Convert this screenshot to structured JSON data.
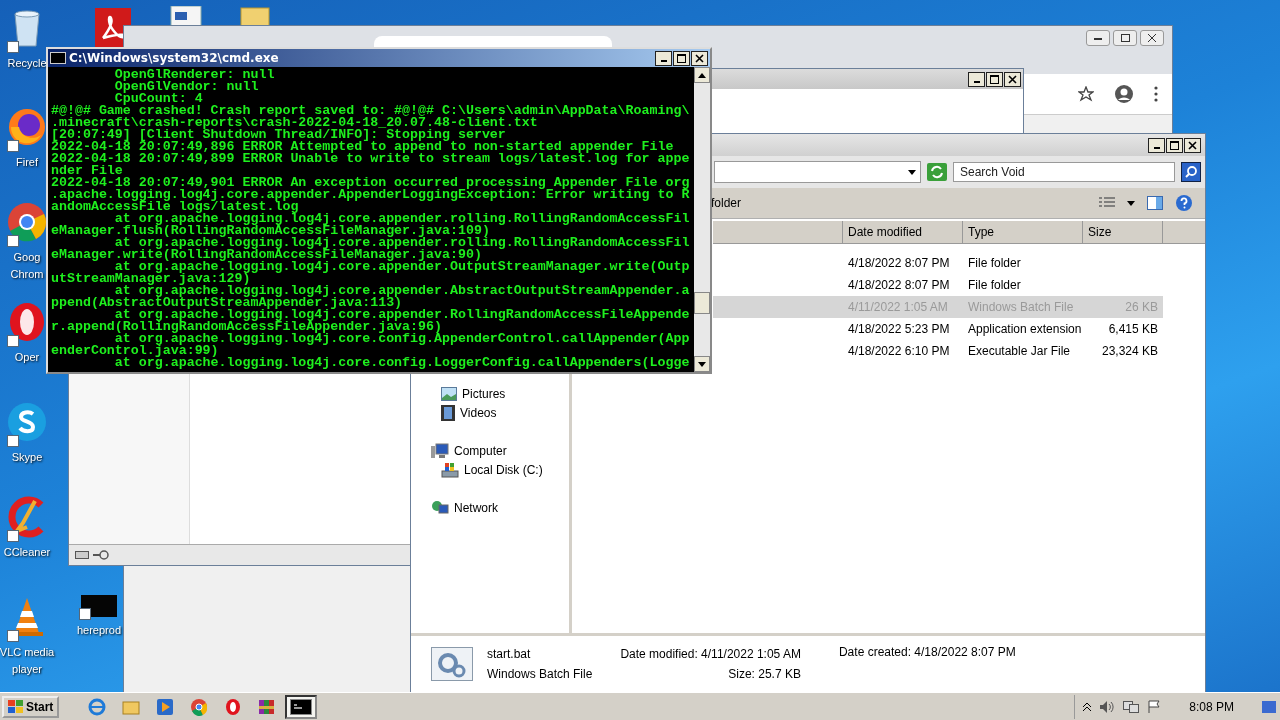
{
  "desktop_icons": [
    {
      "kind": "recycle-bin",
      "lines": [
        "Recycle"
      ]
    },
    {
      "kind": "pdf"
    },
    {
      "kind": "document"
    },
    {
      "kind": "folder"
    },
    {
      "kind": "firefox",
      "lines": [
        "Firef"
      ]
    },
    {
      "kind": "chrome",
      "lines": [
        "Goog",
        "Chrom"
      ]
    },
    {
      "kind": "opera",
      "lines": [
        "Oper"
      ]
    },
    {
      "kind": "skype",
      "lines": [
        "Skype"
      ]
    },
    {
      "kind": "ccleaner",
      "lines": [
        "CCleaner"
      ]
    },
    {
      "kind": "vlc",
      "lines": [
        "VLC media",
        "player"
      ]
    },
    {
      "kind": "black-file",
      "lines": [
        "hereprod"
      ]
    }
  ],
  "cmd_window": {
    "title": "C:\\Windows\\system32\\cmd.exe",
    "lines": [
      "        OpenGlRenderer: null",
      "        OpenGlVendor: null",
      "        CpuCount: 4",
      "#@!@# Game crashed! Crash report saved to: #@!@# C:\\Users\\admin\\AppData\\Roaming\\",
      ".minecraft\\crash-reports\\crash-2022-04-18_20.07.48-client.txt",
      "[20:07:49] [Client Shutdown Thread/INFO]: Stopping server",
      "2022-04-18 20:07:49,896 ERROR Attempted to append to non-started appender File",
      "2022-04-18 20:07:49,899 ERROR Unable to write to stream logs/latest.log for appe",
      "nder File",
      "2022-04-18 20:07:49,901 ERROR An exception occurred processing Appender File org",
      ".apache.logging.log4j.core.appender.AppenderLoggingException: Error writing to R",
      "andomAccessFile logs/latest.log",
      "        at org.apache.logging.log4j.core.appender.rolling.RollingRandomAccessFil",
      "eManager.flush(RollingRandomAccessFileManager.java:109)",
      "        at org.apache.logging.log4j.core.appender.rolling.RollingRandomAccessFil",
      "eManager.write(RollingRandomAccessFileManager.java:90)",
      "        at org.apache.logging.log4j.core.appender.OutputStreamManager.write(Outp",
      "utStreamManager.java:129)",
      "        at org.apache.logging.log4j.core.appender.AbstractOutputStreamAppender.a",
      "ppend(AbstractOutputStreamAppender.java:113)",
      "        at org.apache.logging.log4j.core.appender.RollingRandomAccessFileAppende",
      "r.append(RollingRandomAccessFileAppender.java:96)",
      "        at org.apache.logging.log4j.core.config.AppenderControl.callAppender(App",
      "enderControl.java:99)",
      "        at org.apache.logging.log4j.core.config.LoggerConfig.callAppenders(Logge"
    ]
  },
  "explorer": {
    "search": {
      "placeholder": "Search Void"
    },
    "toolbar_text": "folder",
    "columns": [
      "Date modified",
      "Type",
      "Size"
    ],
    "rows": [
      {
        "date": "4/18/2022 8:07 PM",
        "type": "File folder",
        "size": "",
        "selected": false
      },
      {
        "date": "4/18/2022 8:07 PM",
        "type": "File folder",
        "size": "",
        "selected": false
      },
      {
        "date": "4/11/2022 1:05 AM",
        "type": "Windows Batch File",
        "size": "26 KB",
        "selected": true
      },
      {
        "date": "4/18/2022 5:23 PM",
        "type": "Application extension",
        "size": "6,415 KB",
        "selected": false
      },
      {
        "date": "4/18/2022 6:10 PM",
        "type": "Executable Jar File",
        "size": "23,324 KB",
        "selected": false
      }
    ],
    "nav": [
      {
        "children": [
          {
            "label": "Pictures",
            "kind": "pictures"
          },
          {
            "label": "Videos",
            "kind": "videos"
          }
        ]
      },
      {
        "label": "Computer",
        "kind": "computer",
        "children": [
          {
            "label": "Local Disk (C:)",
            "kind": "disk"
          }
        ]
      },
      {
        "label": "Network",
        "kind": "network"
      }
    ],
    "details": {
      "name": "start.bat",
      "type": "Windows Batch File",
      "fields": [
        {
          "label": "Date modified:",
          "value": "4/11/2022 1:05 AM"
        },
        {
          "label": "Size:",
          "value": "25.7 KB"
        },
        {
          "label": "Date created:",
          "value": "4/18/2022 8:07 PM"
        }
      ]
    }
  },
  "taskbar": {
    "start": "Start",
    "apps": [
      {
        "kind": "ie",
        "selected": false
      },
      {
        "kind": "explorer",
        "selected": false
      },
      {
        "kind": "media",
        "selected": false
      },
      {
        "kind": "chrome",
        "selected": false
      },
      {
        "kind": "opera",
        "selected": false
      },
      {
        "kind": "winrar",
        "selected": false
      },
      {
        "kind": "cmd",
        "selected": true
      }
    ],
    "clock": "8:08 PM"
  }
}
